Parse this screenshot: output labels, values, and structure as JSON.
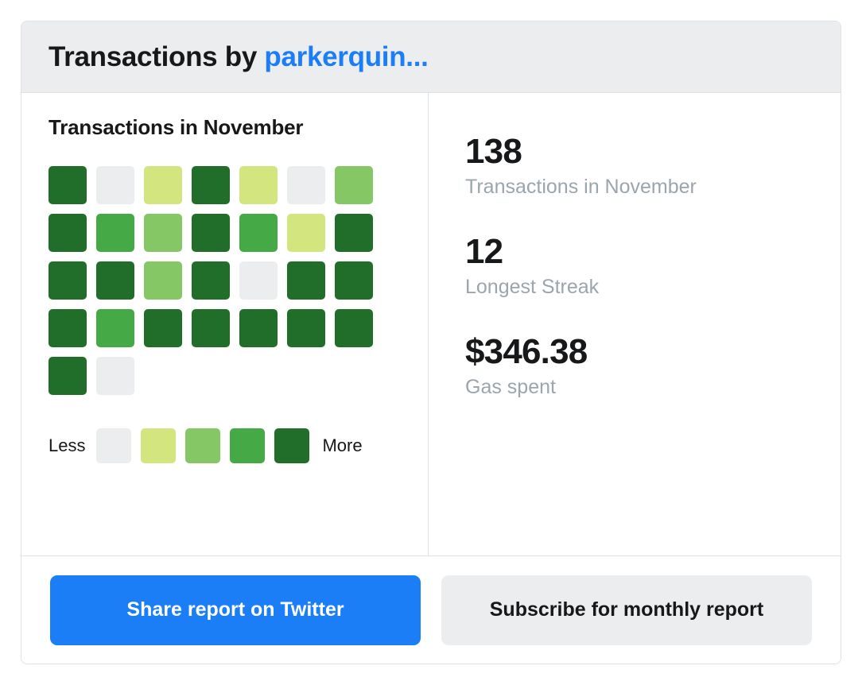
{
  "header": {
    "title_prefix": "Transactions by ",
    "address": "parkerquin..."
  },
  "heatmap": {
    "title": "Transactions in November",
    "legend": {
      "less_label": "Less",
      "more_label": "More",
      "scale": [
        "#ebedef",
        "#d2e57f",
        "#86c765",
        "#45a946",
        "#216e2a"
      ]
    },
    "colors": {
      "empty": "#ebedef",
      "level1": "#d2e57f",
      "level2": "#86c765",
      "level3": "#45a946",
      "level4": "#216e2a"
    },
    "rows": [
      [
        4,
        0,
        1,
        4,
        1,
        0,
        2
      ],
      [
        4,
        3,
        2,
        4,
        3,
        1,
        4
      ],
      [
        4,
        4,
        2,
        4,
        0,
        4,
        4
      ],
      [
        4,
        3,
        4,
        4,
        4,
        4,
        4
      ],
      [
        4,
        0
      ]
    ]
  },
  "stats": [
    {
      "value": "138",
      "label": "Transactions in November"
    },
    {
      "value": "12",
      "label": "Longest Streak"
    },
    {
      "value": "$346.38",
      "label": "Gas spent"
    }
  ],
  "footer": {
    "share_label": "Share report on Twitter",
    "subscribe_label": "Subscribe for monthly report"
  },
  "chart_data": {
    "type": "heatmap",
    "title": "Transactions in November",
    "xlabel": "",
    "ylabel": "",
    "legend_position": "bottom-left",
    "grid": false,
    "level_colors": [
      "#ebedef",
      "#d2e57f",
      "#86c765",
      "#45a946",
      "#216e2a"
    ],
    "level_names": [
      "none",
      "low",
      "medium",
      "high",
      "highest"
    ],
    "legend_min_label": "Less",
    "legend_max_label": "More",
    "columns": 7,
    "rows": 5,
    "values": [
      [
        4,
        0,
        1,
        4,
        1,
        0,
        2
      ],
      [
        4,
        3,
        2,
        4,
        3,
        1,
        4
      ],
      [
        4,
        4,
        2,
        4,
        0,
        4,
        4
      ],
      [
        4,
        3,
        4,
        4,
        4,
        4,
        4
      ],
      [
        4,
        0,
        null,
        null,
        null,
        null,
        null
      ]
    ],
    "summary": {
      "total_transactions": 138,
      "longest_streak": 12,
      "gas_spent_usd": 346.38
    }
  }
}
